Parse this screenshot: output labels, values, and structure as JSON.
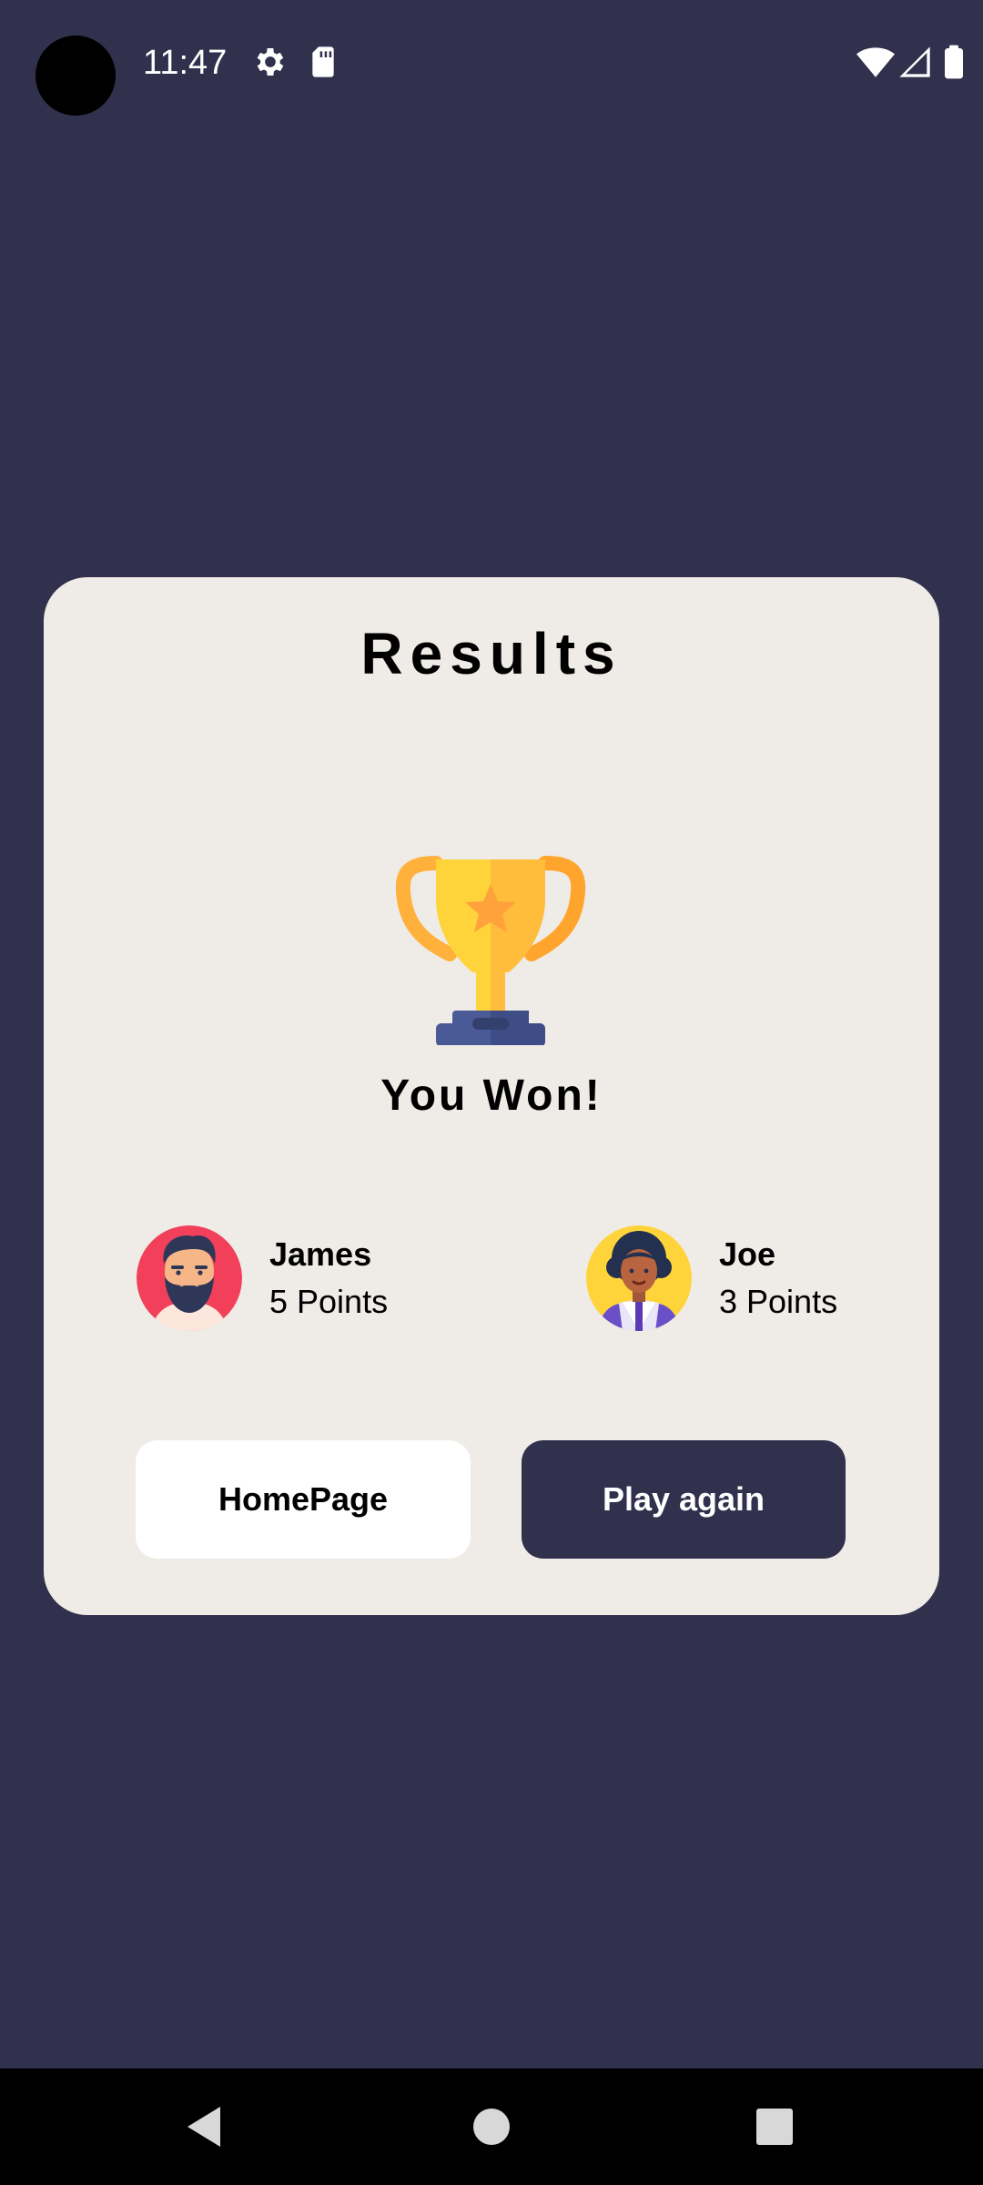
{
  "status_bar": {
    "time": "11:47",
    "icons": [
      "gear-icon",
      "sd-card-icon",
      "wifi-icon",
      "signal-icon",
      "battery-icon"
    ]
  },
  "card": {
    "title": "Results",
    "result_text": "You Won!",
    "players": [
      {
        "name": "James",
        "points": "5 Points",
        "avatar": "bearded-man-avatar"
      },
      {
        "name": "Joe",
        "points": "3 Points",
        "avatar": "curly-hair-person-avatar"
      }
    ],
    "buttons": {
      "home": "HomePage",
      "play_again": "Play again"
    }
  },
  "nav_bar": {
    "icons": [
      "back-icon",
      "home-icon",
      "recents-icon"
    ]
  },
  "colors": {
    "background": "#31304d",
    "card": "#efebe6",
    "primary_button": "#31304d",
    "secondary_button": "#ffffff",
    "trophy_gold": "#ffd43b",
    "trophy_orange": "#ffb13b",
    "trophy_base": "#4a5a96"
  }
}
